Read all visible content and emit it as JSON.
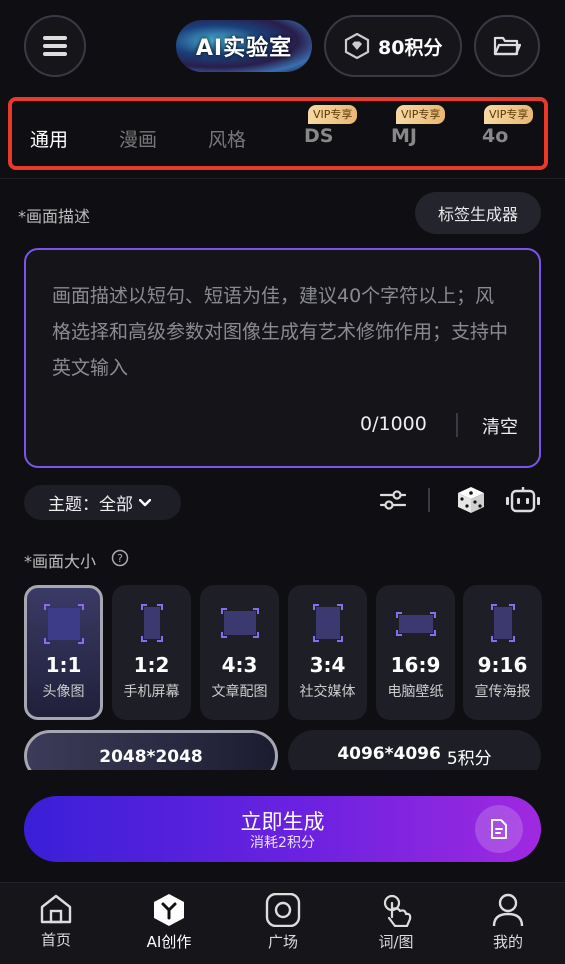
{
  "header": {
    "logo_text": "AI实验室",
    "points": "80积分",
    "icons": {
      "menu": "hamburger-menu-icon",
      "points": "gem-icon",
      "folder": "folder-icon"
    }
  },
  "tabs": [
    {
      "label": "通用",
      "vip": ""
    },
    {
      "label": "漫画",
      "vip": ""
    },
    {
      "label": "风格",
      "vip": ""
    },
    {
      "label": "DS",
      "vip": "VIP专享"
    },
    {
      "label": "MJ",
      "vip": "VIP专享"
    },
    {
      "label": "4o",
      "vip": "VIP专享"
    }
  ],
  "description": {
    "label": "*画面描述",
    "tag_button": "标签生成器",
    "placeholder": "画面描述以短句、短语为佳，建议40个字符以上；风格选择和高级参数对图像生成有艺术修饰作用；支持中英文输入",
    "counter": "0/1000",
    "clear": "清空"
  },
  "theme": {
    "label": "主题：全部"
  },
  "size": {
    "label": "*画面大小",
    "options": [
      {
        "ratio": "1:1",
        "name": "头像图"
      },
      {
        "ratio": "1:2",
        "name": "手机屏幕"
      },
      {
        "ratio": "4:3",
        "name": "文章配图"
      },
      {
        "ratio": "3:4",
        "name": "社交媒体"
      },
      {
        "ratio": "16:9",
        "name": "电脑壁纸"
      },
      {
        "ratio": "9:16",
        "name": "宣传海报"
      }
    ],
    "resolutions": [
      {
        "value": "2048*2048",
        "extra": ""
      },
      {
        "value": "4096*4096",
        "extra": "5积分"
      }
    ]
  },
  "generate": {
    "title": "立即生成",
    "cost": "消耗2积分"
  },
  "nav": [
    {
      "label": "首页"
    },
    {
      "label": "AI创作"
    },
    {
      "label": "广场"
    },
    {
      "label": "词/图"
    },
    {
      "label": "我的"
    }
  ],
  "colors": {
    "accent": "#7a56e8",
    "highlight_box": "#e8392a",
    "vip_gold": "#e9b872"
  }
}
